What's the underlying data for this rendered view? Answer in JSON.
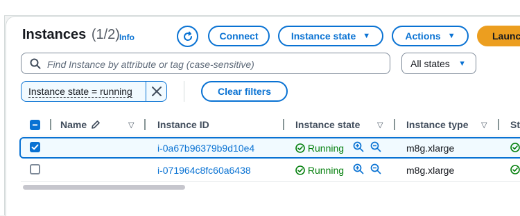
{
  "header": {
    "title": "Instances",
    "count": "(1/2)",
    "info_link": "Info"
  },
  "toolbar": {
    "refresh_icon": "refresh-icon",
    "connect_label": "Connect",
    "instance_state_label": "Instance state",
    "actions_label": "Actions",
    "launch_label": "Launch"
  },
  "filter": {
    "search_placeholder": "Find Instance by attribute or tag (case-sensitive)",
    "states_select_value": "All states",
    "token_label": "Instance state = running",
    "clear_label": "Clear filters"
  },
  "table": {
    "columns": {
      "name": "Name",
      "instance_id": "Instance ID",
      "instance_state": "Instance state",
      "instance_type": "Instance type",
      "status_partial": "St"
    },
    "rows": [
      {
        "selected": true,
        "name": "",
        "instance_id": "i-0a67b96379b9d10e4",
        "state": "Running",
        "type": "m8g.xlarge"
      },
      {
        "selected": false,
        "name": "",
        "instance_id": "i-071964c8fc60a6438",
        "state": "Running",
        "type": "m8g.xlarge"
      }
    ]
  },
  "colors": {
    "accent": "#0972d3",
    "success": "#037f0c",
    "launch": "#ec9e1f"
  }
}
